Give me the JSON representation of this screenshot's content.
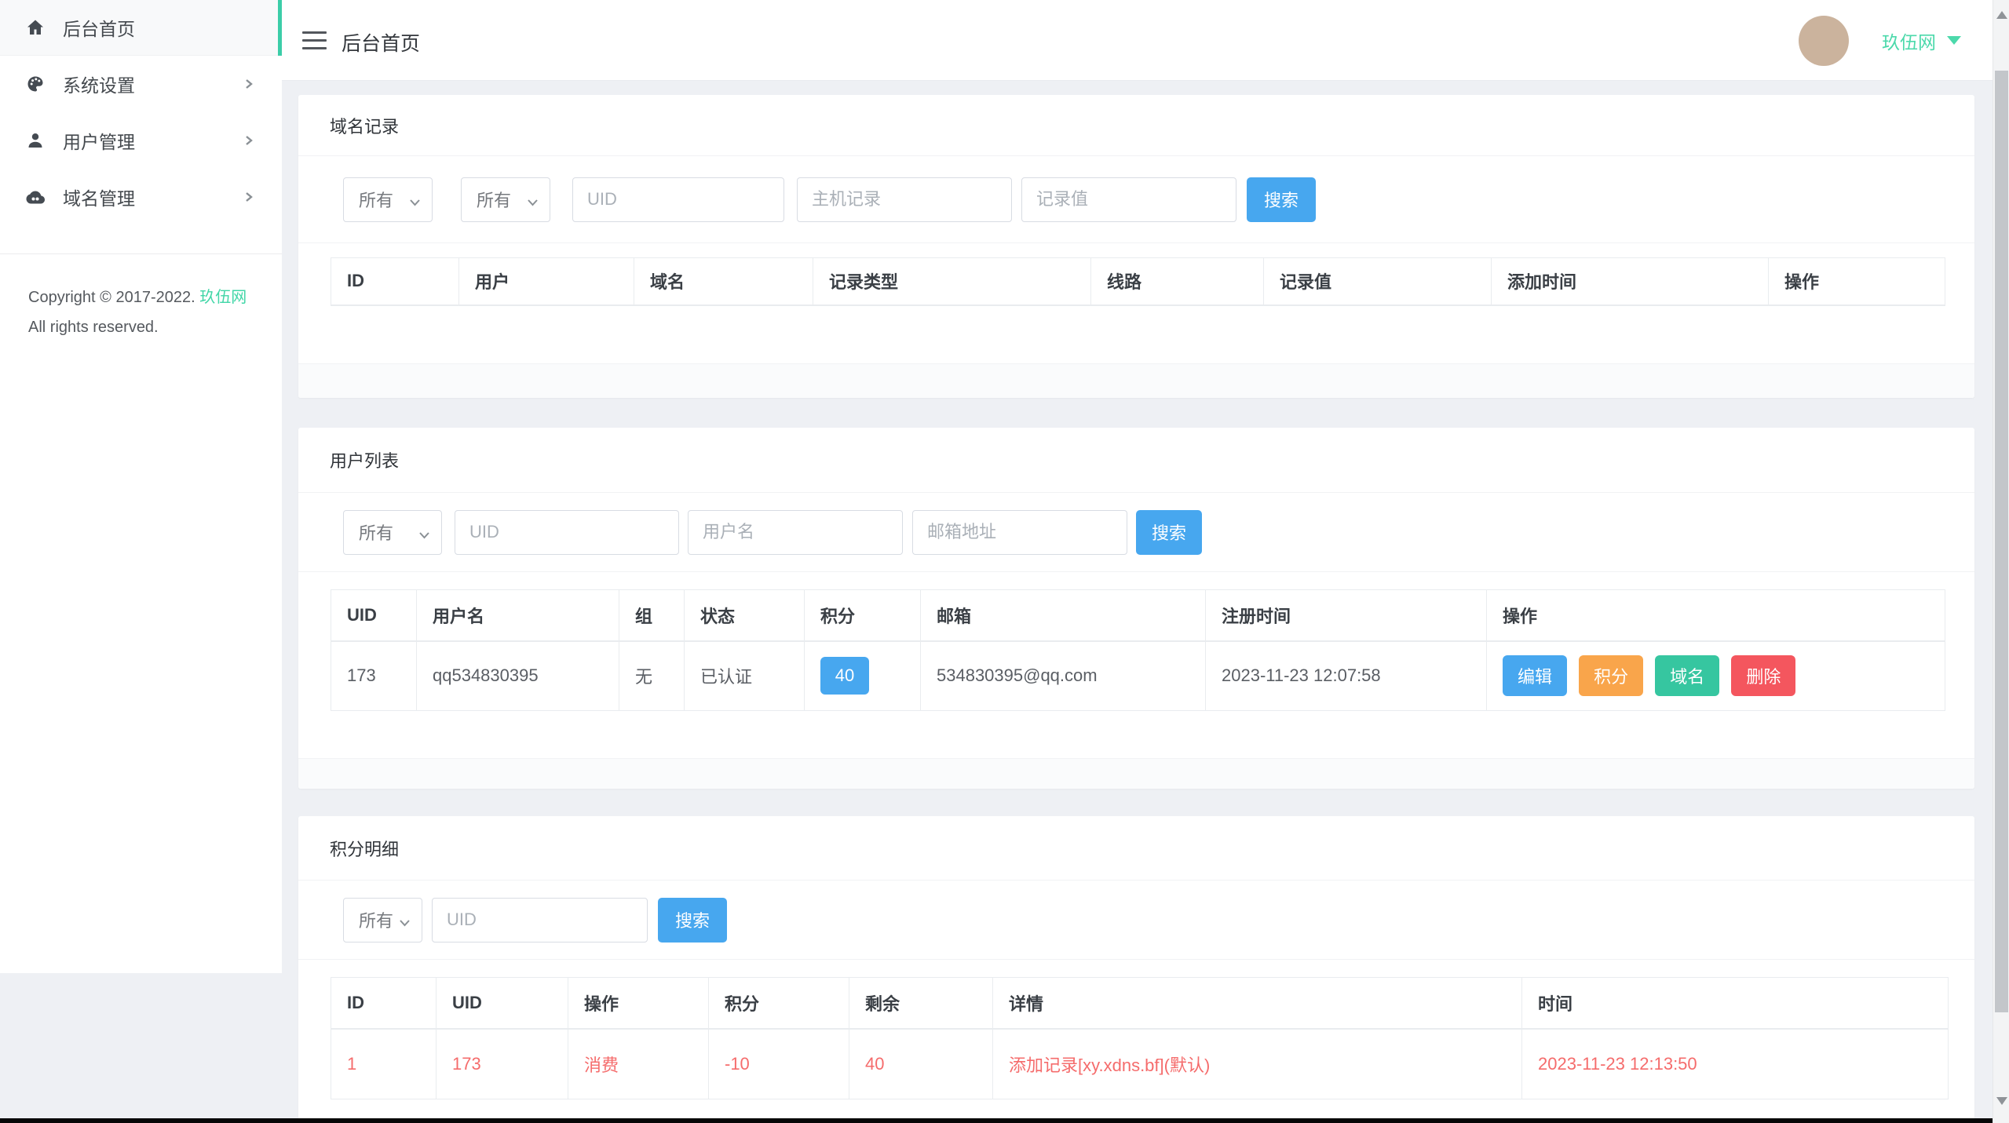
{
  "theme": {
    "accent_teal": "#3bcda8",
    "brand_text_color": "#4cd9ab",
    "primary_blue": "#47a7ef",
    "warning_orange": "#f9a54b",
    "success_green": "#36c6a0",
    "danger_red": "#f4565e",
    "red_row_text": "#f56c6c"
  },
  "sidebar": {
    "items": [
      {
        "label": "后台首页",
        "icon": "home-icon",
        "active": true
      },
      {
        "label": "系统设置",
        "icon": "palette-icon",
        "active": false
      },
      {
        "label": "用户管理",
        "icon": "user-icon",
        "active": false
      },
      {
        "label": "域名管理",
        "icon": "cloud-icon",
        "active": false
      }
    ],
    "copyright": {
      "prefix": "Copyright © 2017-2022.",
      "brand": "玖伍网",
      "line2": "All rights reserved."
    }
  },
  "header": {
    "title": "后台首页",
    "username": "玖伍网"
  },
  "domain_records": {
    "title": "域名记录",
    "filters": {
      "select1": "所有",
      "select2": "所有",
      "uid_placeholder": "UID",
      "host_placeholder": "主机记录",
      "value_placeholder": "记录值",
      "search_label": "搜索"
    },
    "columns": [
      "ID",
      "用户",
      "域名",
      "记录类型",
      "线路",
      "记录值",
      "添加时间",
      "操作"
    ],
    "rows": []
  },
  "user_list": {
    "title": "用户列表",
    "filters": {
      "select": "所有",
      "uid_placeholder": "UID",
      "username_placeholder": "用户名",
      "email_placeholder": "邮箱地址",
      "search_label": "搜索"
    },
    "columns": [
      "UID",
      "用户名",
      "组",
      "状态",
      "积分",
      "邮箱",
      "注册时间",
      "操作"
    ],
    "row": {
      "uid": "173",
      "username": "qq534830395",
      "group": "无",
      "status": "已认证",
      "points": "40",
      "email": "534830395@qq.com",
      "reg_time": "2023-11-23 12:07:58",
      "actions": [
        {
          "label": "编辑",
          "color": "#47a7ef"
        },
        {
          "label": "积分",
          "color": "#f9a54b"
        },
        {
          "label": "域名",
          "color": "#36c6a0"
        },
        {
          "label": "删除",
          "color": "#f4565e"
        }
      ]
    }
  },
  "points_detail": {
    "title": "积分明细",
    "filters": {
      "select": "所有",
      "uid_placeholder": "UID",
      "search_label": "搜索"
    },
    "columns": [
      "ID",
      "UID",
      "操作",
      "积分",
      "剩余",
      "详情",
      "时间"
    ],
    "row": {
      "id": "1",
      "uid": "173",
      "op": "消费",
      "points": "-10",
      "remain": "40",
      "detail": "添加记录[xy.xdns.bf](默认)",
      "time": "2023-11-23 12:13:50"
    }
  }
}
